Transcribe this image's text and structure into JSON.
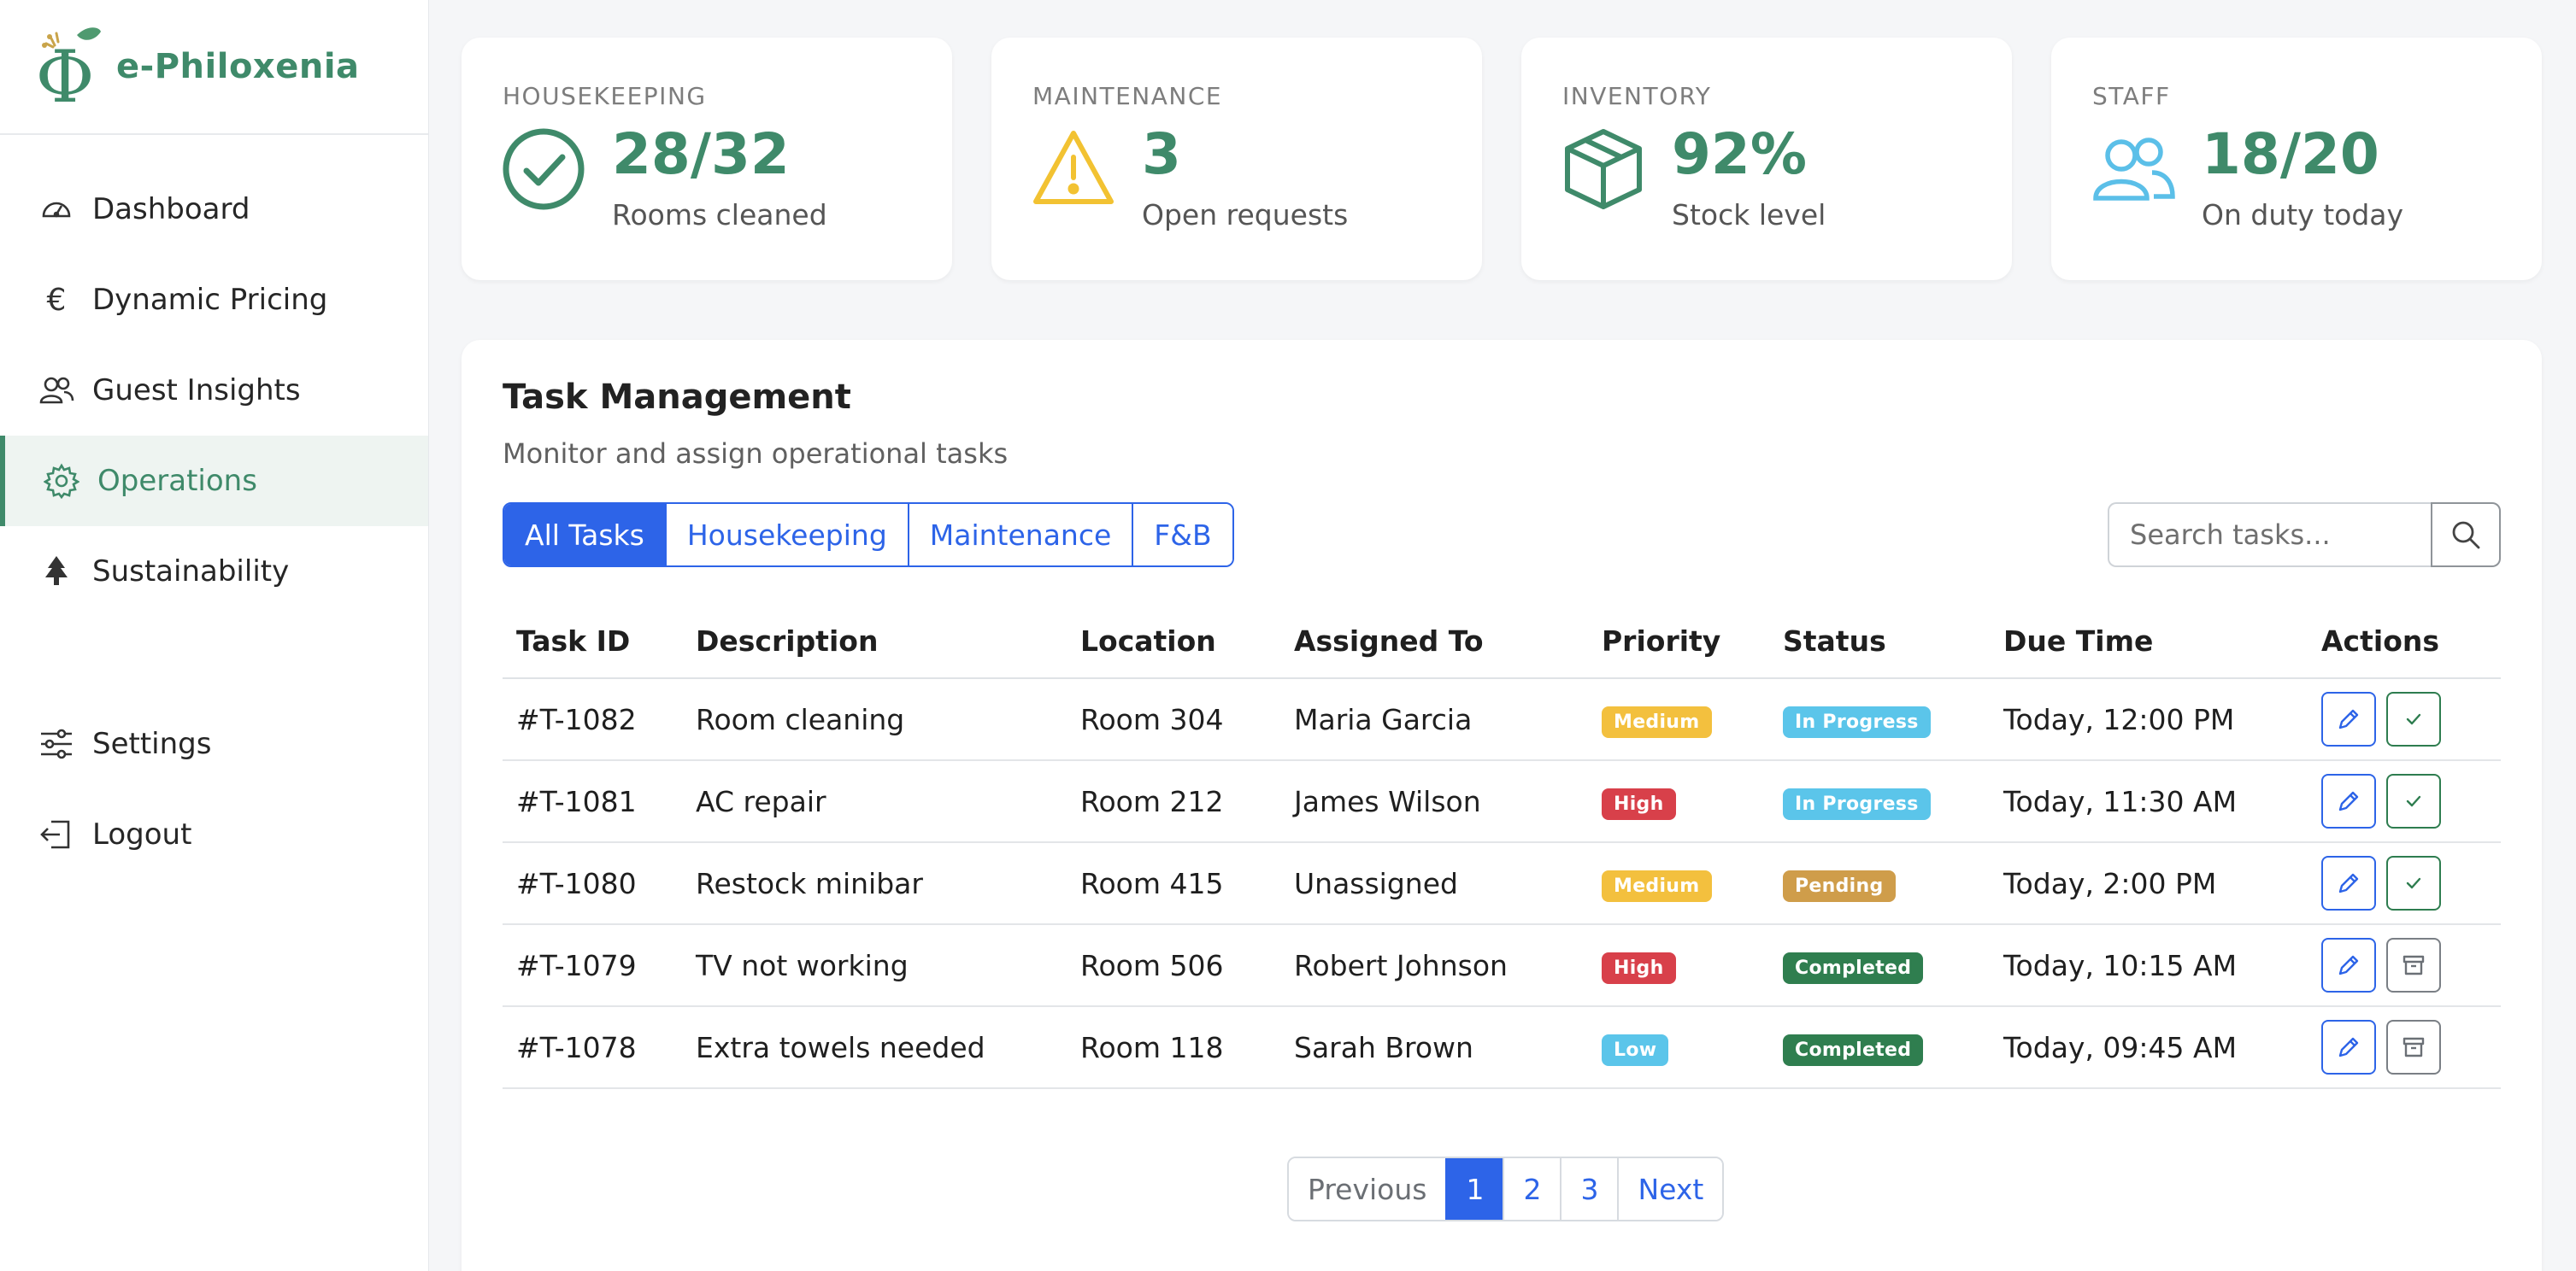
{
  "brand": {
    "name": "e-Philoxenia",
    "logo_glyph": "Φ",
    "color": "#3f8a6a"
  },
  "sidebar": {
    "items": [
      {
        "label": "Dashboard",
        "icon": "speedometer-icon"
      },
      {
        "label": "Dynamic Pricing",
        "icon": "euro-icon"
      },
      {
        "label": "Guest Insights",
        "icon": "people-icon"
      },
      {
        "label": "Operations",
        "icon": "gear-icon",
        "active": true
      },
      {
        "label": "Sustainability",
        "icon": "tree-icon"
      }
    ],
    "bottom_items": [
      {
        "label": "Settings",
        "icon": "sliders-icon"
      },
      {
        "label": "Logout",
        "icon": "logout-icon"
      }
    ]
  },
  "stats": [
    {
      "label": "HOUSEKEEPING",
      "value": "28/32",
      "sub": "Rooms cleaned",
      "icon": "check-circle-icon",
      "icon_color": "#3f8a6a"
    },
    {
      "label": "MAINTENANCE",
      "value": "3",
      "sub": "Open requests",
      "icon": "warning-icon",
      "icon_color": "#f2c232"
    },
    {
      "label": "INVENTORY",
      "value": "92%",
      "sub": "Stock level",
      "icon": "box-icon",
      "icon_color": "#3f8a6a"
    },
    {
      "label": "STAFF",
      "value": "18/20",
      "sub": "On duty today",
      "icon": "people-icon",
      "icon_color": "#5bbfe8"
    }
  ],
  "tasks": {
    "title": "Task Management",
    "subtitle": "Monitor and assign operational tasks",
    "filters": [
      "All Tasks",
      "Housekeeping",
      "Maintenance",
      "F&B"
    ],
    "active_filter": "All Tasks",
    "search_placeholder": "Search tasks...",
    "columns": [
      "Task ID",
      "Description",
      "Location",
      "Assigned To",
      "Priority",
      "Status",
      "Due Time",
      "Actions"
    ],
    "rows": [
      {
        "id": "#T-1082",
        "description": "Room cleaning",
        "location": "Room 304",
        "assigned": "Maria Garcia",
        "priority": "Medium",
        "status": "In Progress",
        "due": "Today, 12:00 PM",
        "second_action": "complete-icon"
      },
      {
        "id": "#T-1081",
        "description": "AC repair",
        "location": "Room 212",
        "assigned": "James Wilson",
        "priority": "High",
        "status": "In Progress",
        "due": "Today, 11:30 AM",
        "second_action": "complete-icon"
      },
      {
        "id": "#T-1080",
        "description": "Restock minibar",
        "location": "Room 415",
        "assigned": "Unassigned",
        "priority": "Medium",
        "status": "Pending",
        "due": "Today, 2:00 PM",
        "second_action": "complete-icon"
      },
      {
        "id": "#T-1079",
        "description": "TV not working",
        "location": "Room 506",
        "assigned": "Robert Johnson",
        "priority": "High",
        "status": "Completed",
        "due": "Today, 10:15 AM",
        "second_action": "archive-icon"
      },
      {
        "id": "#T-1078",
        "description": "Extra towels needed",
        "location": "Room 118",
        "assigned": "Sarah Brown",
        "priority": "Low",
        "status": "Completed",
        "due": "Today, 09:45 AM",
        "second_action": "archive-icon"
      }
    ],
    "badge_colors": {
      "Medium": "#f3c03e",
      "High": "#d8404a",
      "Low": "#5bc5ea",
      "In Progress": "#5bc5ea",
      "Pending": "#cf9d4a",
      "Completed": "#2f7e4f"
    }
  },
  "pagination": {
    "previous": "Previous",
    "pages": [
      "1",
      "2",
      "3"
    ],
    "current": "1",
    "next": "Next"
  }
}
